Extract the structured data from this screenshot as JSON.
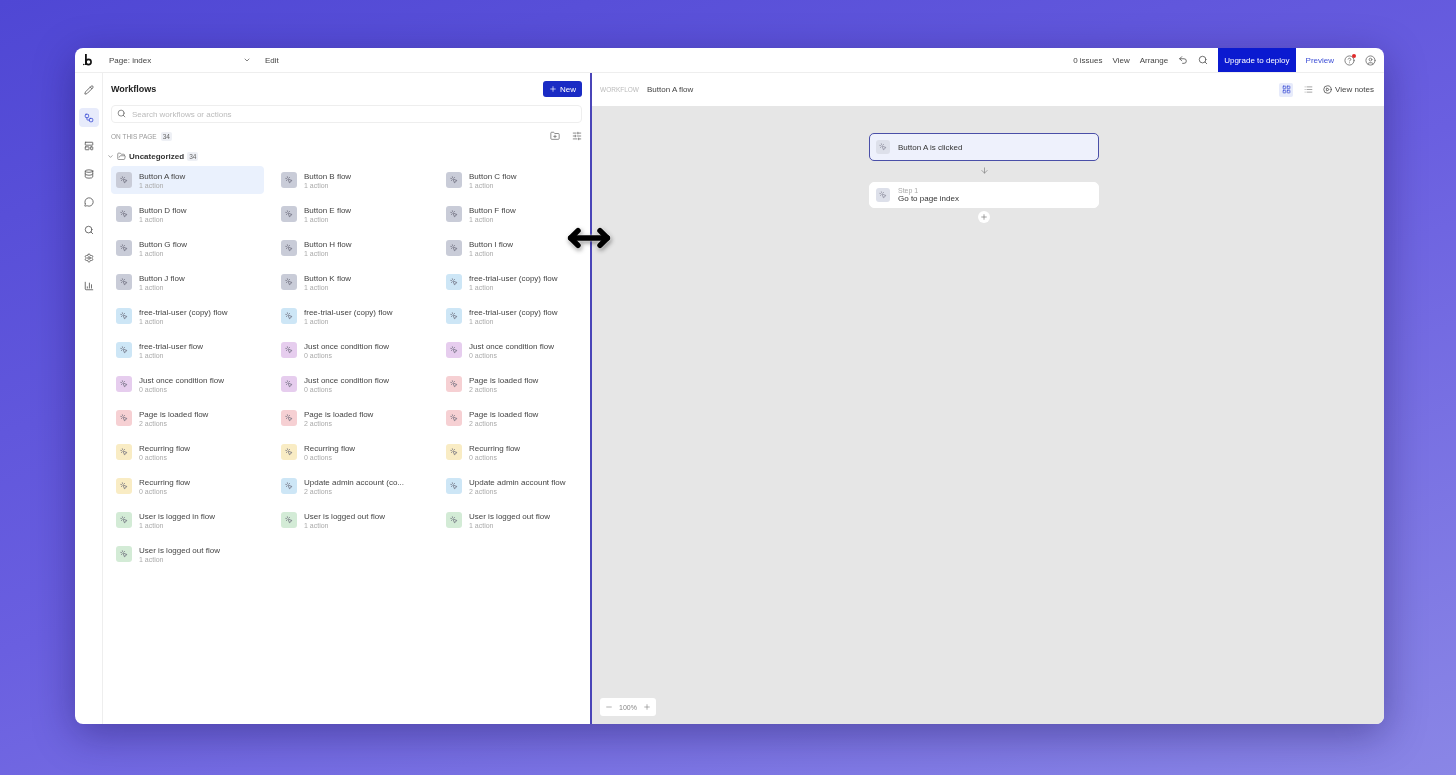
{
  "toolbar": {
    "page": "Page: index",
    "menu": "Edit",
    "issues": "0 issues",
    "view": "View",
    "arrange": "Arrange",
    "upgrade": "Upgrade to deploy",
    "preview": "Preview",
    "help_badge": true
  },
  "rail": [
    {
      "kind": "pencil",
      "selected": false
    },
    {
      "kind": "workflow",
      "selected": true
    },
    {
      "kind": "layout",
      "selected": false
    },
    {
      "kind": "database",
      "selected": false
    },
    {
      "kind": "chat",
      "selected": false
    },
    {
      "kind": "search",
      "selected": false
    },
    {
      "kind": "settings",
      "selected": false
    },
    {
      "kind": "chart",
      "selected": false
    }
  ],
  "panel": {
    "title": "Workflows",
    "new_button": "New",
    "search": {
      "placeholder": "Search workflows or actions"
    },
    "section": "ON THIS PAGE",
    "section_count": "34",
    "folder": {
      "name": "Uncategorized",
      "count": "34",
      "expanded": true
    },
    "workflows": [
      {
        "name": "Button A flow",
        "count": "1 action",
        "color": "#c9ccd8",
        "selected": true
      },
      {
        "name": "Button B flow",
        "count": "1 action",
        "color": "#c9ccd8",
        "selected": false
      },
      {
        "name": "Button C flow",
        "count": "1 action",
        "color": "#c9ccd8",
        "selected": false
      },
      {
        "name": "Button D flow",
        "count": "1 action",
        "color": "#c9ccd8",
        "selected": false
      },
      {
        "name": "Button E flow",
        "count": "1 action",
        "color": "#c9ccd8",
        "selected": false
      },
      {
        "name": "Button F flow",
        "count": "1 action",
        "color": "#c9ccd8",
        "selected": false
      },
      {
        "name": "Button G flow",
        "count": "1 action",
        "color": "#c9ccd8",
        "selected": false
      },
      {
        "name": "Button H flow",
        "count": "1 action",
        "color": "#c9ccd8",
        "selected": false
      },
      {
        "name": "Button I flow",
        "count": "1 action",
        "color": "#c9ccd8",
        "selected": false
      },
      {
        "name": "Button J flow",
        "count": "1 action",
        "color": "#c9ccd8",
        "selected": false
      },
      {
        "name": "Button K flow",
        "count": "1 action",
        "color": "#c9ccd8",
        "selected": false
      },
      {
        "name": "free-trial-user (copy) flow",
        "count": "1 action",
        "color": "#cde6f6",
        "selected": false
      },
      {
        "name": "free-trial-user (copy) flow",
        "count": "1 action",
        "color": "#cde6f6",
        "selected": false
      },
      {
        "name": "free-trial-user (copy) flow",
        "count": "1 action",
        "color": "#cde6f6",
        "selected": false
      },
      {
        "name": "free-trial-user (copy) flow",
        "count": "1 action",
        "color": "#cde6f6",
        "selected": false
      },
      {
        "name": "free-trial-user flow",
        "count": "1 action",
        "color": "#cde6f6",
        "selected": false
      },
      {
        "name": "Just once condition flow",
        "count": "0 actions",
        "color": "#e6cdee",
        "selected": false
      },
      {
        "name": "Just once condition flow",
        "count": "0 actions",
        "color": "#e6cdee",
        "selected": false
      },
      {
        "name": "Just once condition flow",
        "count": "0 actions",
        "color": "#e6cdee",
        "selected": false
      },
      {
        "name": "Just once condition flow",
        "count": "0 actions",
        "color": "#e6cdee",
        "selected": false
      },
      {
        "name": "Page is loaded flow",
        "count": "2 actions",
        "color": "#f6d0d3",
        "selected": false
      },
      {
        "name": "Page is loaded flow",
        "count": "2 actions",
        "color": "#f6d0d3",
        "selected": false
      },
      {
        "name": "Page is loaded flow",
        "count": "2 actions",
        "color": "#f6d0d3",
        "selected": false
      },
      {
        "name": "Page is loaded flow",
        "count": "2 actions",
        "color": "#f6d0d3",
        "selected": false
      },
      {
        "name": "Recurring flow",
        "count": "0 actions",
        "color": "#f9ecc4",
        "selected": false
      },
      {
        "name": "Recurring flow",
        "count": "0 actions",
        "color": "#f9ecc4",
        "selected": false
      },
      {
        "name": "Recurring flow",
        "count": "0 actions",
        "color": "#f9ecc4",
        "selected": false
      },
      {
        "name": "Recurring flow",
        "count": "0 actions",
        "color": "#f9ecc4",
        "selected": false
      },
      {
        "name": "Update admin account (co...",
        "count": "2 actions",
        "color": "#cde6f6",
        "selected": false
      },
      {
        "name": "Update admin account flow",
        "count": "2 actions",
        "color": "#cde6f6",
        "selected": false
      },
      {
        "name": "User is logged in flow",
        "count": "1 action",
        "color": "#d3ebd6",
        "selected": false
      },
      {
        "name": "User is logged out flow",
        "count": "1 action",
        "color": "#d3ebd6",
        "selected": false
      },
      {
        "name": "User is logged out flow",
        "count": "1 action",
        "color": "#d3ebd6",
        "selected": false
      },
      {
        "name": "User is logged out flow",
        "count": "1 action",
        "color": "#d3ebd6",
        "selected": false
      }
    ]
  },
  "canvas": {
    "breadcrumb": "WORKFLOW",
    "flow_name": "Button A flow",
    "view_modes": [
      {
        "kind": "grid",
        "selected": true
      },
      {
        "kind": "list",
        "selected": false
      }
    ],
    "notes_button": "View notes",
    "nodes": [
      {
        "label": "Button A is clicked",
        "selected": true
      },
      {
        "step": "Step 1",
        "label": "Go to page index",
        "selected": false
      }
    ],
    "zoom": "100%"
  }
}
